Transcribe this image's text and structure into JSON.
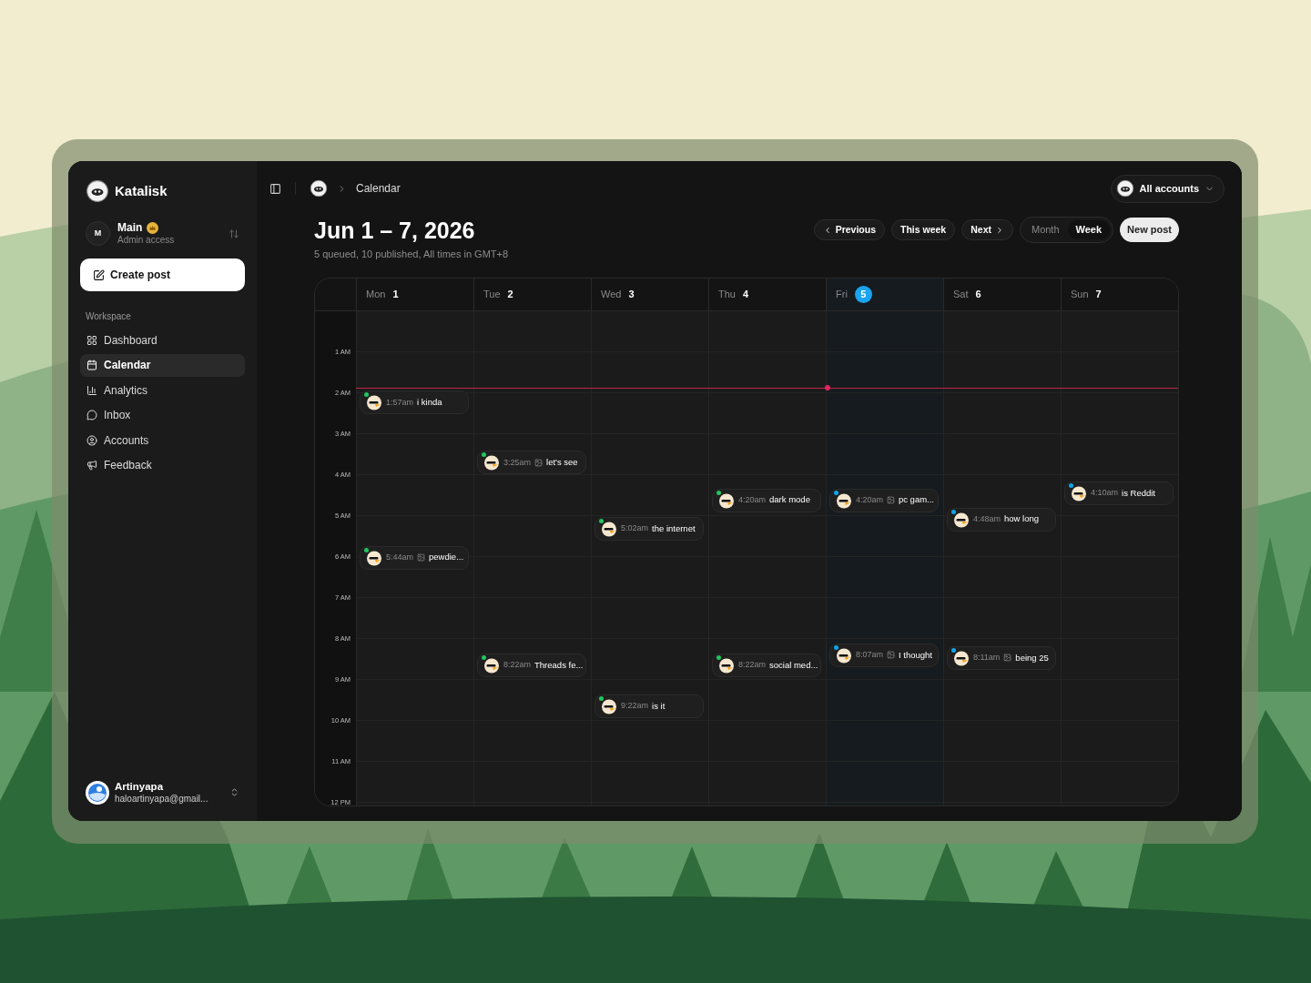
{
  "sidebar": {
    "brand": "Katalisk",
    "workspace_switcher": {
      "initial": "M",
      "name": "Main",
      "subtitle": "Admin access"
    },
    "create_button": "Create post",
    "section_label": "Workspace",
    "items": [
      {
        "kind": "dashboard",
        "label": "Dashboard",
        "selected": false
      },
      {
        "kind": "calendar",
        "label": "Calendar",
        "selected": true
      },
      {
        "kind": "analytics",
        "label": "Analytics",
        "selected": false
      },
      {
        "kind": "inbox",
        "label": "Inbox",
        "selected": false
      },
      {
        "kind": "accounts",
        "label": "Accounts",
        "selected": false
      },
      {
        "kind": "feedback",
        "label": "Feedback",
        "selected": false
      }
    ],
    "user": {
      "name": "Artinyapa",
      "email": "haloartinyapa@gmail..."
    }
  },
  "breadcrumb": {
    "current": "Calendar"
  },
  "account_picker": {
    "label": "All accounts"
  },
  "header": {
    "title": "Jun 1 – 7, 2026",
    "subtitle": "5 queued, 10 published, All times in GMT+8"
  },
  "nav_buttons": {
    "previous": "Previous",
    "this_week": "This week",
    "next": "Next"
  },
  "views": [
    {
      "label": "Month",
      "selected": false
    },
    {
      "label": "Week",
      "selected": true
    }
  ],
  "new_post": "New post",
  "days": [
    {
      "name": "Mon",
      "date": "1",
      "today": false,
      "posts": [
        {
          "time": "1:57am",
          "title": "i kinda",
          "has_image": false,
          "color": "#22c55e"
        },
        {
          "time": "5:44am",
          "title": "pewdie...",
          "has_image": true,
          "color": "#22c55e"
        }
      ]
    },
    {
      "name": "Tue",
      "date": "2",
      "today": false,
      "posts": [
        {
          "time": "3:25am",
          "title": "let's see",
          "has_image": true,
          "color": "#22c55e"
        },
        {
          "time": "8:22am",
          "title": "Threads fe...",
          "has_image": false,
          "color": "#22c55e"
        }
      ]
    },
    {
      "name": "Wed",
      "date": "3",
      "today": false,
      "posts": [
        {
          "time": "5:02am",
          "title": "the internet",
          "has_image": false,
          "color": "#22c55e"
        },
        {
          "time": "9:22am",
          "title": "is it",
          "has_image": false,
          "color": "#22c55e"
        }
      ]
    },
    {
      "name": "Thu",
      "date": "4",
      "today": false,
      "posts": [
        {
          "time": "4:20am",
          "title": "dark mode",
          "has_image": false,
          "color": "#22c55e"
        },
        {
          "time": "8:22am",
          "title": "social med...",
          "has_image": false,
          "color": "#22c55e"
        }
      ]
    },
    {
      "name": "Fri",
      "date": "5",
      "today": true,
      "posts": [
        {
          "time": "4:20am",
          "title": "pc gam...",
          "has_image": true,
          "color": "#0ea5e9"
        },
        {
          "time": "8:07am",
          "title": "I thought",
          "has_image": true,
          "color": "#0ea5e9"
        }
      ]
    },
    {
      "name": "Sat",
      "date": "6",
      "today": false,
      "posts": [
        {
          "time": "4:48am",
          "title": "how long",
          "has_image": false,
          "color": "#0ea5e9"
        },
        {
          "time": "8:11am",
          "title": "being 25",
          "has_image": true,
          "color": "#0ea5e9"
        }
      ]
    },
    {
      "name": "Sun",
      "date": "7",
      "today": false,
      "posts": [
        {
          "time": "4:10am",
          "title": "is Reddit",
          "has_image": false,
          "color": "#0ea5e9"
        }
      ]
    }
  ],
  "hours": [
    "1 AM",
    "2 AM",
    "3 AM",
    "4 AM",
    "5 AM",
    "6 AM",
    "7 AM",
    "8 AM",
    "9 AM",
    "10 AM",
    "11 AM",
    "12 PM"
  ]
}
